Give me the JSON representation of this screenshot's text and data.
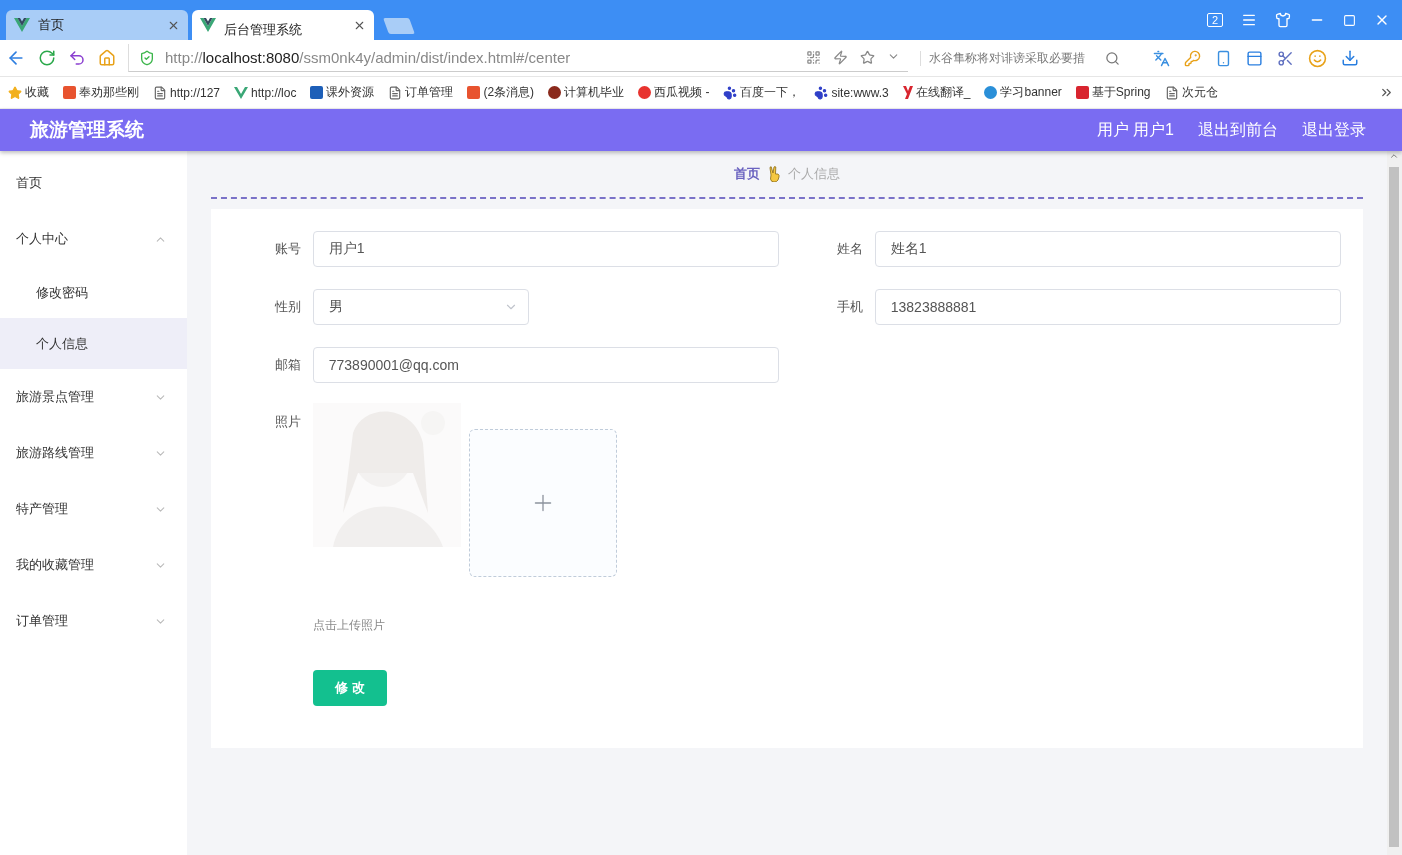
{
  "browser": {
    "tabs": [
      {
        "title": "首页",
        "selected": false
      },
      {
        "title": "后台管理系统",
        "selected": true
      }
    ],
    "window_badge": "2",
    "url": {
      "prefix": "http://",
      "host": "localhost:8080",
      "path": "/ssm0nk4y/admin/dist/index.html#/center"
    },
    "search": {
      "placeholder": "水谷隼称将对诽谤采取必要措"
    },
    "bookmarks": [
      {
        "kind": "star",
        "label": "收藏",
        "color": "#f2b01e"
      },
      {
        "kind": "letter",
        "label": "奉劝那些刚",
        "color": "#e8532f"
      },
      {
        "kind": "doc",
        "label": "http://127",
        "color": "#666666"
      },
      {
        "kind": "vue",
        "label": "http://loc",
        "color": "#3aa776"
      },
      {
        "kind": "square",
        "label": "课外资源",
        "color": "#1d5fb8"
      },
      {
        "kind": "doc",
        "label": "订单管理",
        "color": "#666666"
      },
      {
        "kind": "letter",
        "label": "(2条消息)",
        "color": "#e8532f"
      },
      {
        "kind": "dot",
        "label": "计算机毕业",
        "color": "#8a2a1c"
      },
      {
        "kind": "dot",
        "label": "西瓜视频 -",
        "color": "#e8332f"
      },
      {
        "kind": "paw",
        "label": "百度一下，",
        "color": "#2f3fc8"
      },
      {
        "kind": "paw",
        "label": "site:www.3",
        "color": "#2f3fc8"
      },
      {
        "kind": "y",
        "label": "在线翻译_",
        "color": "#d8252f"
      },
      {
        "kind": "dot",
        "label": "学习banner",
        "color": "#2a8fd8"
      },
      {
        "kind": "letter",
        "label": "基于Spring",
        "color": "#d8252f"
      },
      {
        "kind": "doc",
        "label": "次元仓",
        "color": "#666666"
      }
    ]
  },
  "app": {
    "title": "旅游管理系统",
    "header_links": [
      "用户 用户1",
      "退出到前台",
      "退出登录"
    ]
  },
  "sidebar": {
    "items": [
      {
        "label": "首页",
        "kind": "link",
        "selected": false
      },
      {
        "label": "个人中心",
        "kind": "group",
        "expanded": true,
        "children": [
          {
            "label": "修改密码",
            "selected": false
          },
          {
            "label": "个人信息",
            "selected": true
          }
        ]
      },
      {
        "label": "旅游景点管理",
        "kind": "group",
        "expanded": false
      },
      {
        "label": "旅游路线管理",
        "kind": "group",
        "expanded": false
      },
      {
        "label": "特产管理",
        "kind": "group",
        "expanded": false
      },
      {
        "label": "我的收藏管理",
        "kind": "group",
        "expanded": false
      },
      {
        "label": "订单管理",
        "kind": "group",
        "expanded": false
      }
    ]
  },
  "breadcrumb": [
    {
      "label": "首页",
      "selected": true
    },
    {
      "label": "个人信息",
      "selected": false
    }
  ],
  "form": {
    "fields": [
      {
        "label": "账号",
        "kind": "input",
        "value": "用户1"
      },
      {
        "label": "姓名",
        "kind": "input",
        "value": "姓名1"
      },
      {
        "label": "性别",
        "kind": "select",
        "value": "男"
      },
      {
        "label": "手机",
        "kind": "input",
        "value": "13823888881"
      },
      {
        "label": "邮箱",
        "kind": "input",
        "value": "773890001@qq.com"
      }
    ],
    "photo": {
      "label": "照片",
      "hint": "点击上传照片"
    },
    "submit": "修 改"
  }
}
